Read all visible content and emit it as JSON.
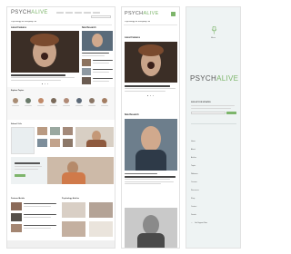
{
  "desktop": {
    "logo_part1": "PSYCH",
    "logo_part2": "ALIVE",
    "tagline": "Psychology for Everyday Life",
    "latest_features_heading": "Latest Features",
    "new_research_heading": "New Research",
    "section_circles_heading": "Explore Topics",
    "school_heading": "School / Life",
    "bottom_left_heading": "Featured Article",
    "bottom_right_heading": "Psychology Articles"
  },
  "tablet": {
    "logo_part1": "PSYCH",
    "logo_part2": "ALIVE",
    "tagline": "Psychology for Everyday Life",
    "latest_features_heading": "Latest Features",
    "new_research_heading": "New Research"
  },
  "sidenav": {
    "menu_label": "Menu",
    "logo_part1": "PSYCH",
    "logo_part2": "ALIVE",
    "signup_heading": "SIGN UP FOR UPDATES",
    "items": [
      "Home",
      "About",
      "Articles",
      "Topics",
      "Webinars",
      "Courses",
      "Resources",
      "Shop",
      "Contact",
      "Donate"
    ],
    "footer_link": "Get Support Now"
  },
  "colors": {
    "brand_green": "#7db56b",
    "sidebar_bg": "#eef3f3"
  }
}
